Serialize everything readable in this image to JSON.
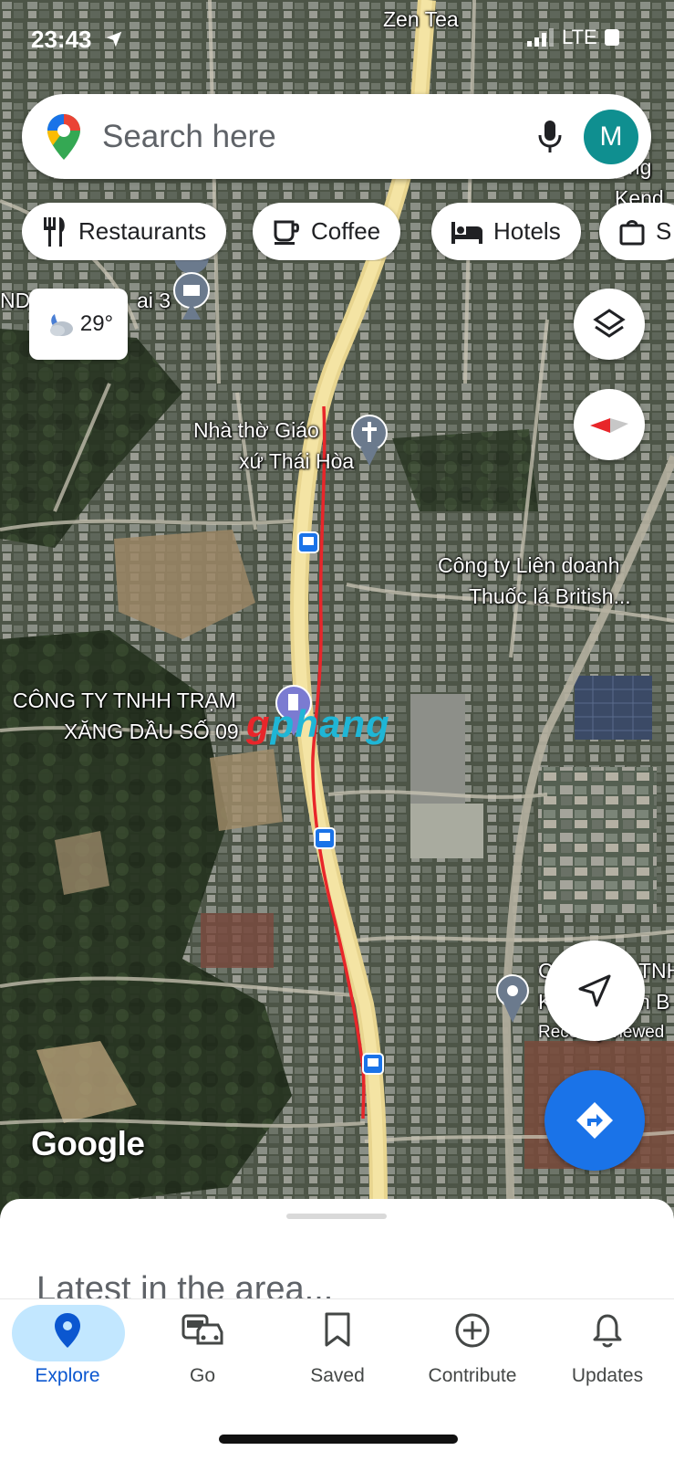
{
  "status_bar": {
    "time": "23:43",
    "carrier": "LTE"
  },
  "search": {
    "placeholder": "Search here",
    "avatar_letter": "M"
  },
  "chips": [
    {
      "label": "Restaurants",
      "icon": "fork-knife-icon"
    },
    {
      "label": "Coffee",
      "icon": "coffee-cup-icon"
    },
    {
      "label": "Hotels",
      "icon": "bed-icon"
    },
    {
      "label": "S",
      "icon": "shopping-bag-icon"
    }
  ],
  "weather": {
    "temp": "29°",
    "icon": "partly-cloudy-night-icon"
  },
  "map_labels": {
    "zen_tea": "Zen Tea",
    "top_left": "ND",
    "top_left_2": "ai 3",
    "church_1": "Nhà thờ Giáo",
    "church_2": "xứ Thái Hòa",
    "company_1": "Công ty Liên doanh",
    "company_2": "Thuốc lá British...",
    "gas_1": "CÔNG TY TNHH TRẠM",
    "gas_2": "XĂNG DẦU SỐ 09",
    "right_top_1": "ong",
    "right_top_2": "Kend",
    "right_mid_1": "C",
    "right_mid_2": "TNH",
    "right_mid_3": "K",
    "right_mid_4": "n B",
    "recently_viewed": "Recently viewed",
    "watermark_first": "g",
    "watermark_rest": "phang",
    "google": "Google"
  },
  "bottom_sheet": {
    "title": "Latest in the area..."
  },
  "nav": [
    {
      "label": "Explore",
      "icon": "pin-icon",
      "active": true
    },
    {
      "label": "Go",
      "icon": "commute-icon",
      "active": false
    },
    {
      "label": "Saved",
      "icon": "bookmark-icon",
      "active": false
    },
    {
      "label": "Contribute",
      "icon": "add-circle-icon",
      "active": false
    },
    {
      "label": "Updates",
      "icon": "bell-icon",
      "active": false
    }
  ],
  "colors": {
    "accent": "#1a73e8",
    "route": "#e8262a",
    "road": "#f2d98c",
    "active_pill": "#c2e7ff"
  }
}
